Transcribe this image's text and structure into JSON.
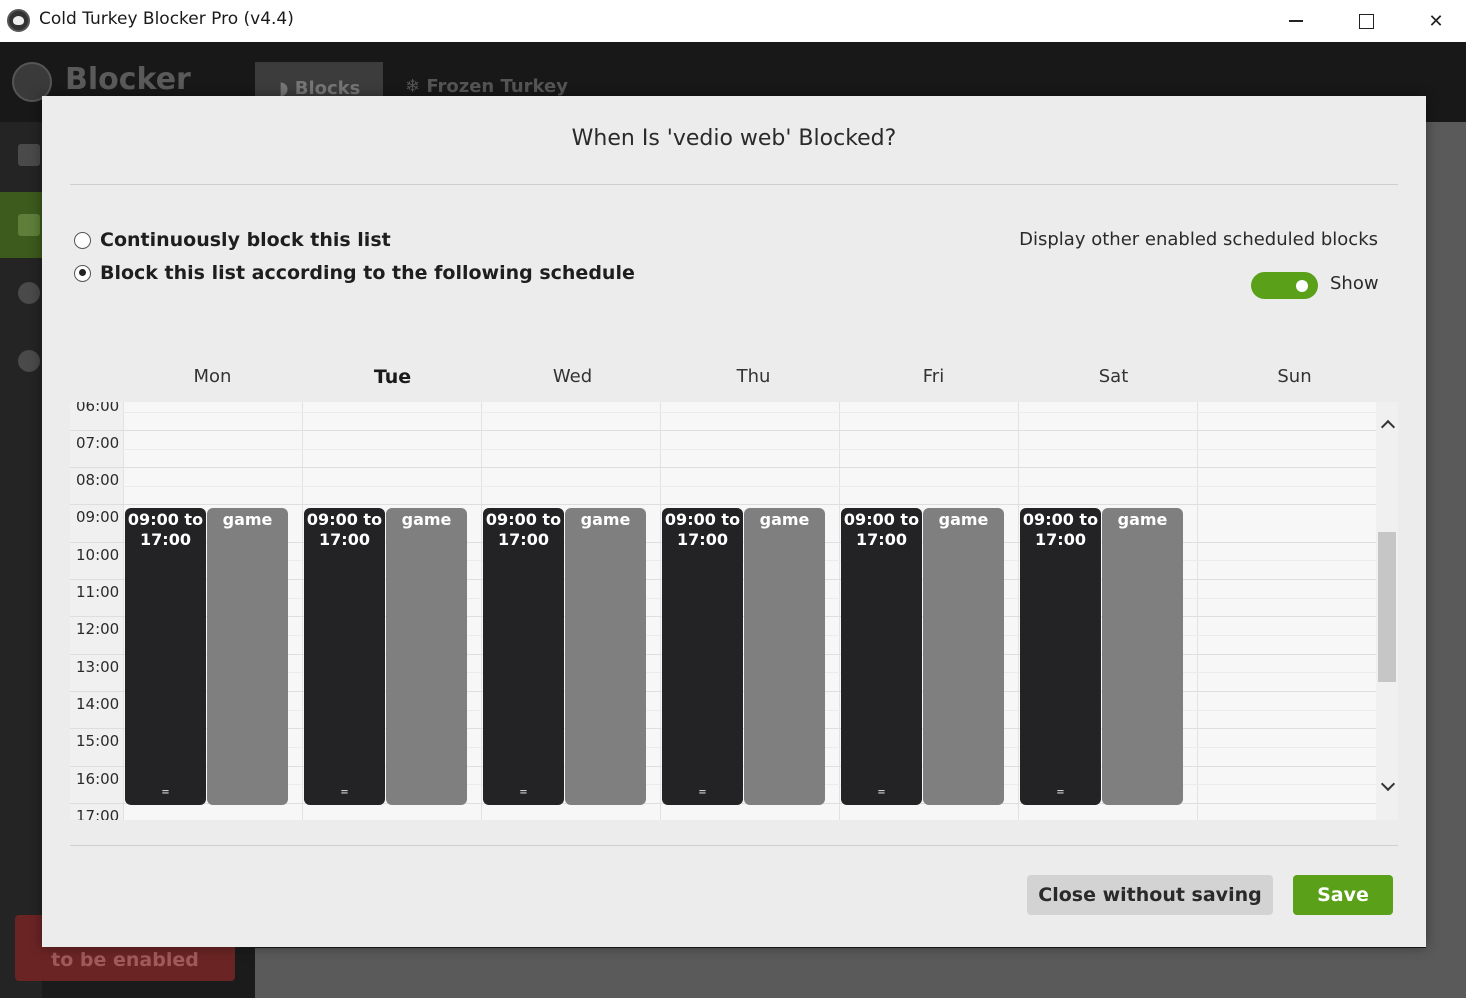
{
  "window": {
    "title": "Cold Turkey Blocker Pro (v4.4)"
  },
  "background": {
    "brand": "Blocker",
    "tab_blocks": "Blocks",
    "tab_frozen": "Frozen Turkey",
    "enable_button": "to be enabled"
  },
  "modal": {
    "title": "When Is 'vedio web' Blocked?",
    "option_continuous": "Continuously block this list",
    "option_schedule": "Block this list according to the following schedule",
    "selected_option": "schedule",
    "display_label": "Display other enabled scheduled blocks",
    "toggle_label": "Show",
    "toggle_on": true,
    "close_button": "Close without saving",
    "save_button": "Save"
  },
  "calendar": {
    "days": [
      "Mon",
      "Tue",
      "Wed",
      "Thu",
      "Fri",
      "Sat",
      "Sun"
    ],
    "today": "Tue",
    "times": [
      "06:00",
      "07:00",
      "08:00",
      "09:00",
      "10:00",
      "11:00",
      "12:00",
      "13:00",
      "14:00",
      "15:00",
      "16:00",
      "17:00"
    ],
    "blocks": [
      {
        "day": "Mon",
        "label_line1": "09:00 to",
        "label_line2": "17:00",
        "other": "game",
        "grip": "="
      },
      {
        "day": "Tue",
        "label_line1": "09:00 to",
        "label_line2": "17:00",
        "other": "game",
        "grip": "="
      },
      {
        "day": "Wed",
        "label_line1": "09:00 to",
        "label_line2": "17:00",
        "other": "game",
        "grip": "="
      },
      {
        "day": "Thu",
        "label_line1": "09:00 to",
        "label_line2": "17:00",
        "other": "game",
        "grip": "="
      },
      {
        "day": "Fri",
        "label_line1": "09:00 to",
        "label_line2": "17:00",
        "other": "game",
        "grip": "="
      },
      {
        "day": "Sat",
        "label_line1": "09:00 to",
        "label_line2": "17:00",
        "other": "game",
        "grip": "="
      }
    ]
  },
  "colors": {
    "accent_green": "#5aa119",
    "block_dark": "#232325",
    "block_other": "#7f7f80"
  }
}
